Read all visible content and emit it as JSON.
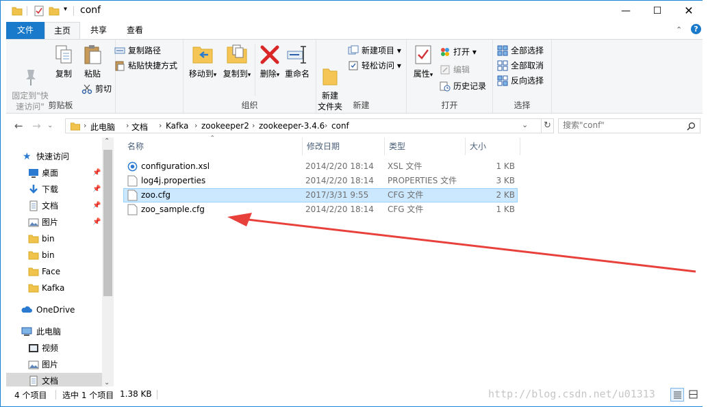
{
  "window": {
    "title": "conf"
  },
  "ribbon_tabs": [
    "文件",
    "主页",
    "共享",
    "查看"
  ],
  "ribbon": {
    "clipboard": {
      "label": "剪贴板",
      "pin_quick": "固定到\"快\n速访问\"",
      "copy": "复制",
      "paste": "粘贴",
      "copy_path": "复制路径",
      "paste_shortcut": "粘贴快捷方式",
      "cut": "剪切"
    },
    "organize": {
      "label": "组织",
      "move_to": "移动到",
      "copy_to": "复制到",
      "delete": "删除",
      "rename": "重命名"
    },
    "new": {
      "label": "新建",
      "new_folder": "新建\n文件夹",
      "new_item": "新建项目",
      "easy_access": "轻松访问"
    },
    "open": {
      "label": "打开",
      "properties": "属性",
      "open": "打开",
      "edit": "编辑",
      "history": "历史记录"
    },
    "select": {
      "label": "选择",
      "select_all": "全部选择",
      "select_none": "全部取消",
      "invert": "反向选择"
    }
  },
  "address": {
    "crumbs": [
      "此电脑",
      "文档",
      "Kafka",
      "zookeeper2",
      "zookeeper-3.4.6",
      "conf"
    ],
    "search_placeholder": "搜索\"conf\""
  },
  "nav": {
    "quick_access": "快速访问",
    "items": [
      {
        "label": "桌面",
        "icon": "desktop-icon",
        "pinned": true
      },
      {
        "label": "下载",
        "icon": "download-icon",
        "pinned": true
      },
      {
        "label": "文档",
        "icon": "document-icon",
        "pinned": true
      },
      {
        "label": "图片",
        "icon": "picture-icon",
        "pinned": true
      },
      {
        "label": "bin",
        "icon": "folder-icon",
        "pinned": false
      },
      {
        "label": "bin",
        "icon": "folder-icon",
        "pinned": false
      },
      {
        "label": "Face",
        "icon": "folder-icon",
        "pinned": false
      },
      {
        "label": "Kafka",
        "icon": "folder-icon",
        "pinned": false
      }
    ],
    "onedrive": "OneDrive",
    "this_pc": "此电脑",
    "pc_items": [
      {
        "label": "视频",
        "icon": "video-icon"
      },
      {
        "label": "图片",
        "icon": "picture-icon"
      },
      {
        "label": "文档",
        "icon": "document-icon"
      }
    ]
  },
  "columns": {
    "name": "名称",
    "date": "修改日期",
    "type": "类型",
    "size": "大小"
  },
  "files": [
    {
      "name": "configuration.xsl",
      "date": "2014/2/20 18:14",
      "type": "XSL 文件",
      "size": "1 KB",
      "selected": false
    },
    {
      "name": "log4j.properties",
      "date": "2014/2/20 18:14",
      "type": "PROPERTIES 文件",
      "size": "3 KB",
      "selected": false
    },
    {
      "name": "zoo.cfg",
      "date": "2017/3/31 9:55",
      "type": "CFG 文件",
      "size": "2 KB",
      "selected": true
    },
    {
      "name": "zoo_sample.cfg",
      "date": "2014/2/20 18:14",
      "type": "CFG 文件",
      "size": "1 KB",
      "selected": false
    }
  ],
  "status": {
    "count": "4 个项目",
    "selected": "选中 1 个项目",
    "size": "1.38 KB"
  },
  "watermark": "http://blog.csdn.net/u01313",
  "colors": {
    "accent": "#1979ca",
    "selection": "#cce8ff",
    "arrow": "#e8413b"
  }
}
